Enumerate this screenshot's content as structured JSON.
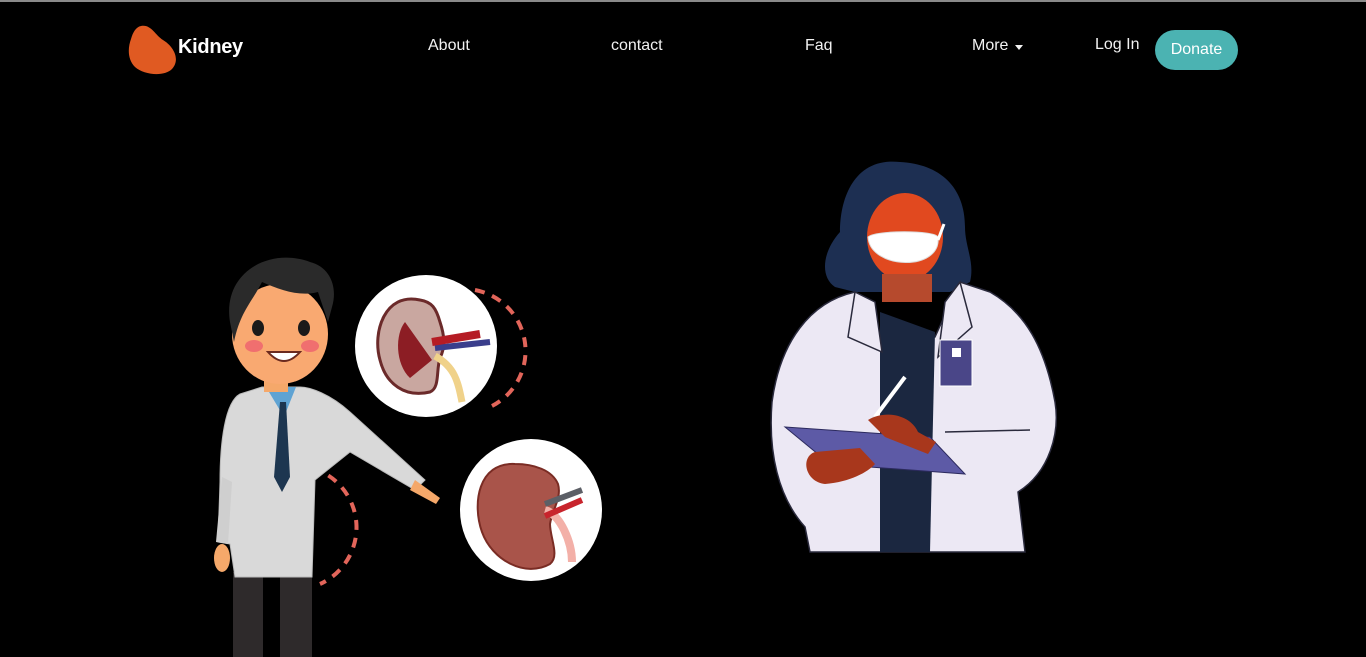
{
  "brand": {
    "name": "Kidney",
    "logo_icon": "kidney-blob-icon",
    "logo_color": "#e05a22"
  },
  "nav": {
    "links": [
      {
        "label": "About"
      },
      {
        "label": "contact"
      },
      {
        "label": "Faq"
      },
      {
        "label": "More",
        "icon": "caret-down-icon"
      }
    ],
    "login_label": "Log In",
    "donate_label": "Donate"
  },
  "colors": {
    "background": "#000000",
    "accent": "#4bb3b2"
  },
  "hero": {
    "left_illustration": "doctor-presenting-kidneys",
    "right_illustration": "female-doctor-with-clipboard"
  }
}
